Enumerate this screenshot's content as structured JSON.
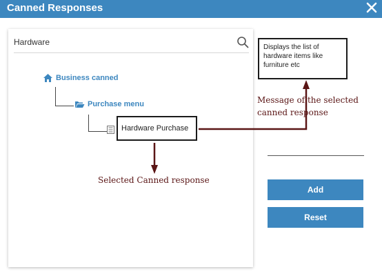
{
  "dialog": {
    "title": "Canned Responses",
    "close_icon": "close-icon"
  },
  "search": {
    "value": "Hardware",
    "icon": "search-icon"
  },
  "tree": {
    "business": {
      "label": "Business canned",
      "icon": "home-icon"
    },
    "purchase_menu": {
      "label": "Purchase menu",
      "icon": "folder-open-icon"
    },
    "hardware_purchase": {
      "label": "Hardware Purchase",
      "icon": "document-icon"
    }
  },
  "message_preview": {
    "text": "Displays the list of hardware items like furniture etc"
  },
  "annotations": {
    "message_label": "Message of the selected canned response",
    "selected_label": "Selected Canned response"
  },
  "buttons": {
    "add": "Add",
    "reset": "Reset"
  },
  "colors": {
    "accent": "#3d87bf",
    "annotation": "#5a1515"
  }
}
